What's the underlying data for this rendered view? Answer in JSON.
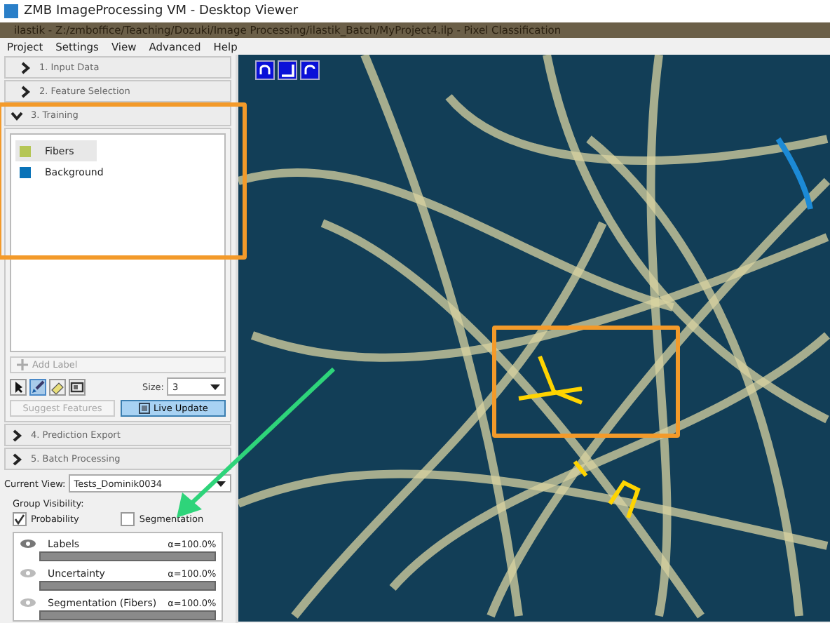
{
  "window": {
    "title": "ZMB ImageProcessing VM - Desktop Viewer"
  },
  "app_title": "ilastik - Z:/zmboffice/Teaching/Dozuki/Image Processing/ilastik_Batch/MyProject4.ilp - Pixel Classification",
  "menu": [
    "Project",
    "Settings",
    "View",
    "Advanced",
    "Help"
  ],
  "steps_before": [
    {
      "label": "1. Input Data",
      "expanded": false
    },
    {
      "label": "2. Feature Selection",
      "expanded": false
    }
  ],
  "training": {
    "label": "3. Training",
    "expanded": true,
    "labels": [
      {
        "name": "Fibers",
        "color": "#b5c655",
        "selected": true
      },
      {
        "name": "Background",
        "color": "#0a73b8",
        "selected": false
      }
    ],
    "add_label": "Add Label",
    "tools": [
      {
        "kind": "pointer",
        "selected": false
      },
      {
        "kind": "brush",
        "selected": true
      },
      {
        "kind": "eraser",
        "selected": false
      },
      {
        "kind": "select",
        "selected": false
      }
    ],
    "size_label": "Size:",
    "size_value": "3",
    "suggest_features": {
      "label": "Suggest Features",
      "disabled": true
    },
    "live_update": {
      "label": "Live Update",
      "on": true
    }
  },
  "steps_after": [
    {
      "label": "4. Prediction Export",
      "expanded": false
    },
    {
      "label": "5. Batch Processing",
      "expanded": false
    }
  ],
  "current_view": {
    "label": "Current View:",
    "value": "Tests_Dominik0034"
  },
  "group_visibility": {
    "label": "Group Visibility:",
    "options": [
      {
        "label": "Probability",
        "checked": true
      },
      {
        "label": "Segmentation",
        "checked": false
      }
    ]
  },
  "layers": [
    {
      "name": "Labels",
      "opacity": "α=100.0%",
      "level": 1,
      "visible": true
    },
    {
      "name": "Uncertainty",
      "opacity": "α=100.0%",
      "level": 1,
      "visible": false
    },
    {
      "name": "Segmentation (Fibers)",
      "opacity": "α=100.0%",
      "level": 1,
      "visible": false
    }
  ]
}
